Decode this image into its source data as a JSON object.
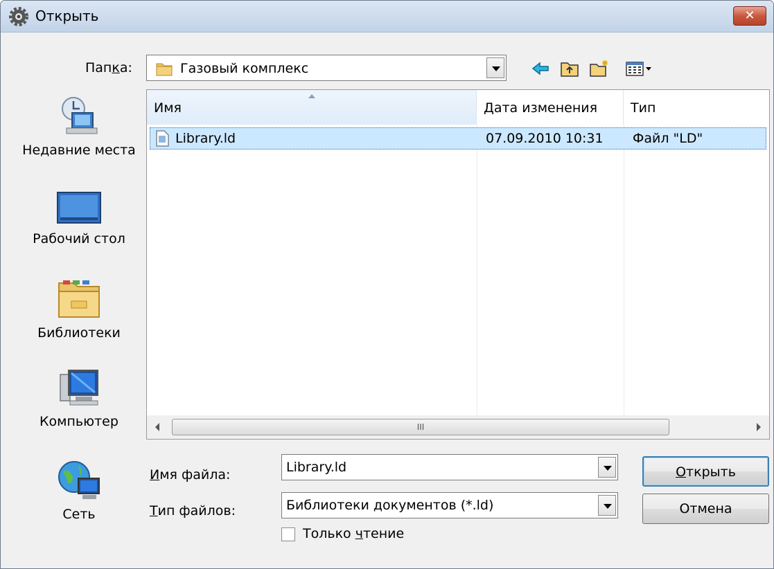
{
  "window": {
    "title": "Открыть",
    "close_label": "✕"
  },
  "folder_bar": {
    "label_prefix": "Пап",
    "label_accel": "к",
    "label_suffix": "а:",
    "current_folder": "Газовый комплекс",
    "tools": [
      "back-icon",
      "up-folder-icon",
      "new-folder-icon",
      "view-menu-icon"
    ]
  },
  "places": [
    {
      "label": "Недавние места",
      "icon": "recent-places-icon"
    },
    {
      "label": "Рабочий стол",
      "icon": "desktop-icon"
    },
    {
      "label": "Библиотеки",
      "icon": "libraries-icon"
    },
    {
      "label": "Компьютер",
      "icon": "computer-icon"
    },
    {
      "label": "Сеть",
      "icon": "network-icon"
    }
  ],
  "file_list": {
    "columns": [
      "Имя",
      "Дата изменения",
      "Тип"
    ],
    "rows": [
      {
        "name": "Library.ld",
        "date": "07.09.2010 10:31",
        "type": "Файл \"LD\""
      }
    ],
    "scroll_thumb_grip": "III"
  },
  "file_name": {
    "label_accel": "И",
    "label_rest": "мя файла:",
    "value": "Library.ld"
  },
  "file_type": {
    "label_accel": "Т",
    "label_rest": "ип файлов:",
    "value": "Библиотеки документов (*.ld)"
  },
  "read_only": {
    "label_prefix": "Только ",
    "label_accel": "ч",
    "label_suffix": "тение",
    "checked": false
  },
  "buttons": {
    "open_accel": "О",
    "open_rest": "ткрыть",
    "cancel": "Отмена"
  },
  "colors": {
    "selection": "#cce8ff",
    "title_bar": "#c2d3e8",
    "close_button": "#c75a3f"
  }
}
